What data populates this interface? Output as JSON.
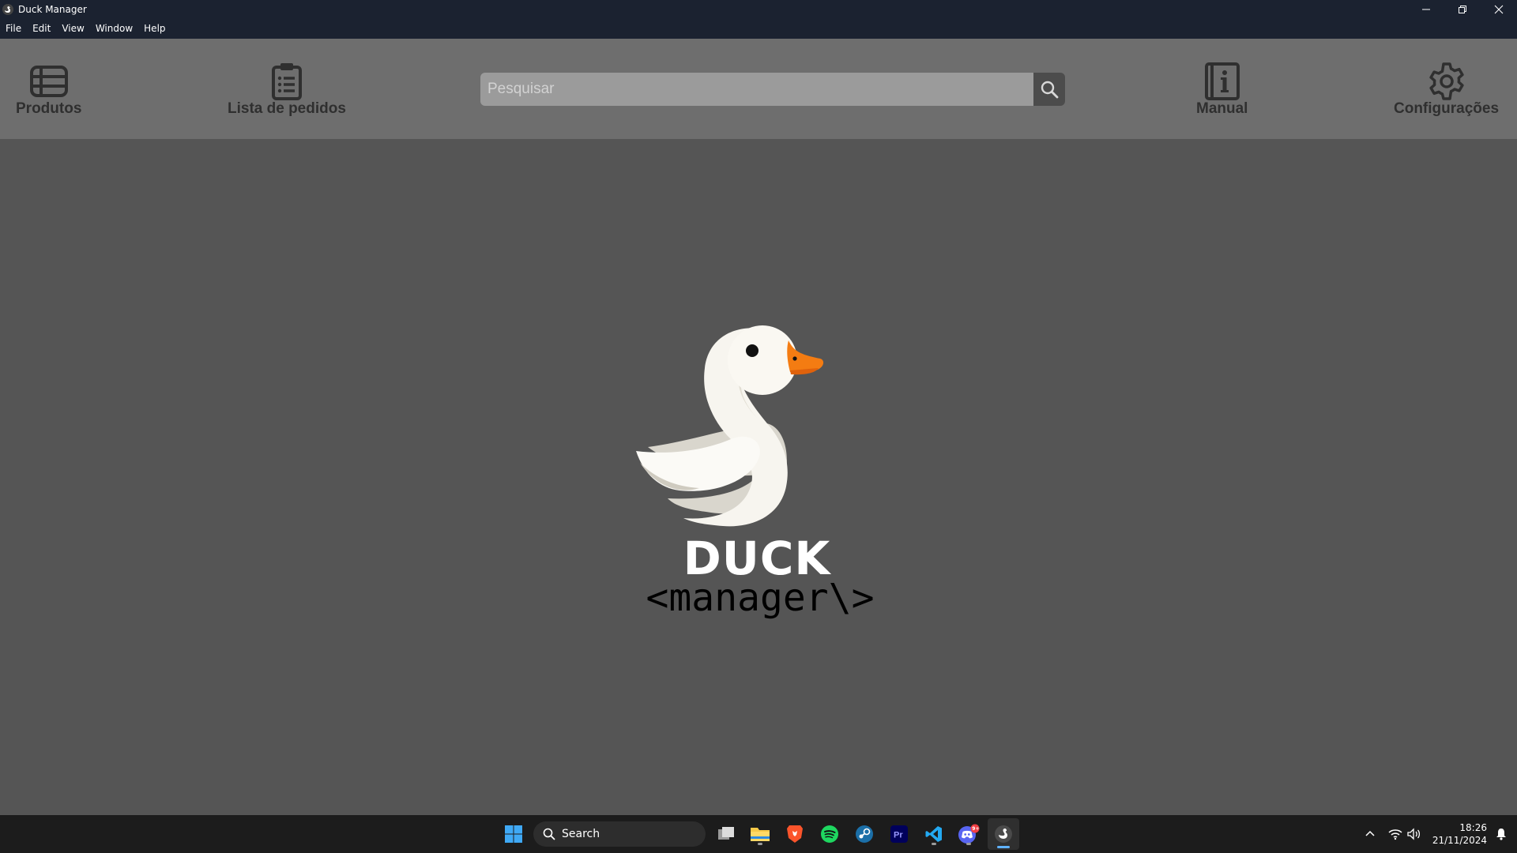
{
  "window": {
    "title": "Duck Manager"
  },
  "menu": [
    "File",
    "Edit",
    "View",
    "Window",
    "Help"
  ],
  "toolbar": {
    "products_label": "Produtos",
    "orders_label": "Lista de pedidos",
    "manual_label": "Manual",
    "settings_label": "Configurações"
  },
  "search": {
    "placeholder": "Pesquisar",
    "value": ""
  },
  "logo": {
    "brand_line1": "DUCK",
    "brand_line2": "<manager\\>"
  },
  "taskbar": {
    "search_label": "Search",
    "apps": [
      "start-icon",
      "task-view-icon",
      "file-explorer-icon",
      "brave-icon",
      "spotify-icon",
      "steam-icon",
      "premiere-icon",
      "vscode-icon",
      "discord-icon",
      "duck-manager-icon"
    ],
    "discord_badge": "9+",
    "premiere_text": "Pr",
    "time": "18:26",
    "date": "21/11/2024"
  },
  "colors": {
    "titlebar": "#1b2230",
    "toolbar": "#6e6e6e",
    "main_bg": "#555555",
    "search_field": "#9b9b9b",
    "search_button": "#4c4c4c",
    "beak": "#f47c12",
    "taskbar": "#1c1c1c"
  }
}
